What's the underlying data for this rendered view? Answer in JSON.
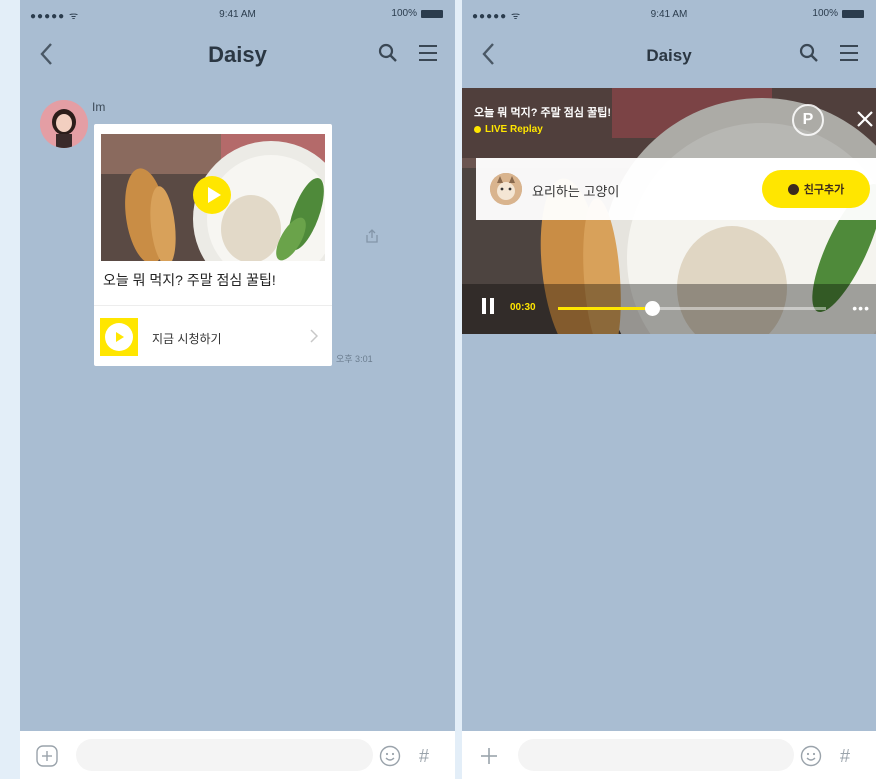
{
  "left_screen": {
    "status_bar": {
      "signal": "●●●●● ᯤ",
      "time": "9:41 AM",
      "battery": "100%"
    },
    "nav": {
      "title": "Daisy"
    },
    "message": {
      "sender": "Im",
      "card_title": "오늘 뭐 먹지? 주말 점심 꿀팁!",
      "watch_label": "지금 시청하기",
      "time": "오후 3:01"
    },
    "input": {
      "placeholder": "",
      "hash_label": "#"
    }
  },
  "right_screen": {
    "status_bar": {
      "signal": "●●●●● ᯤ",
      "time": "9:41 AM",
      "battery": "100%"
    },
    "nav": {
      "title": "Daisy"
    },
    "player": {
      "title": "오늘 뭐 먹지? 주말 점심 꿀팁!",
      "badge": "LIVE Replay",
      "pin_label": "P",
      "channel_name": "요리하는 고양이",
      "add_friend_label": "친구추가",
      "elapsed": "00:30",
      "progress": 0.35,
      "more_label": "•••"
    },
    "input": {
      "placeholder": "",
      "hash_label": "#"
    }
  },
  "colors": {
    "chat_background": "#a9bdd2",
    "accent_yellow": "#ffe600",
    "page_background": "#e3eef8"
  }
}
